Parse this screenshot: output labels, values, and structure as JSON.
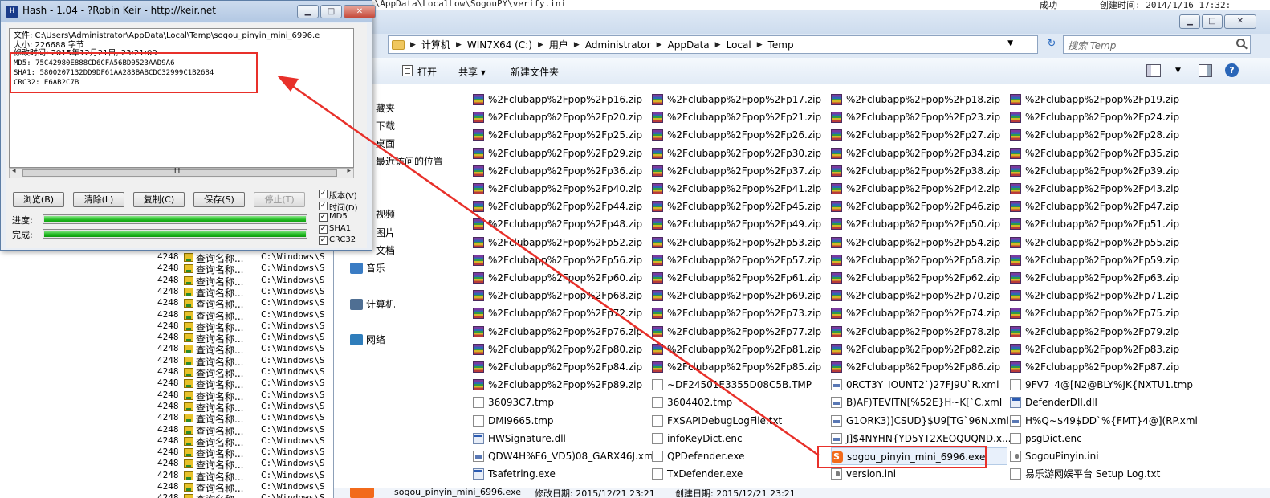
{
  "background_top": {
    "path_fragment": "r\\AppData\\LocalLow\\SogouPY\\verify.ini",
    "result": "成功",
    "created": "创建时间: 2014/1/16 17:32:"
  },
  "log": {
    "rows": [
      {
        "pid": "4248",
        "op": "查询名称...",
        "path": "C:\\Windows\\S"
      },
      {
        "pid": "4248",
        "op": "查询名称...",
        "path": "C:\\Windows\\S"
      },
      {
        "pid": "4248",
        "op": "查询名称...",
        "path": "C:\\Windows\\S"
      },
      {
        "pid": "4248",
        "op": "查询名称...",
        "path": "C:\\Windows\\S"
      },
      {
        "pid": "4248",
        "op": "查询名称...",
        "path": "C:\\Windows\\S"
      },
      {
        "pid": "4248",
        "op": "查询名称...",
        "path": "C:\\Windows\\S"
      },
      {
        "pid": "4248",
        "op": "查询名称...",
        "path": "C:\\Windows\\S"
      },
      {
        "pid": "4248",
        "op": "查询名称...",
        "path": "C:\\Windows\\S"
      },
      {
        "pid": "4248",
        "op": "查询名称...",
        "path": "C:\\Windows\\S"
      },
      {
        "pid": "4248",
        "op": "查询名称...",
        "path": "C:\\Windows\\S"
      },
      {
        "pid": "4248",
        "op": "查询名称...",
        "path": "C:\\Windows\\S"
      },
      {
        "pid": "4248",
        "op": "查询名称...",
        "path": "C:\\Windows\\S"
      },
      {
        "pid": "4248",
        "op": "查询名称...",
        "path": "C:\\Windows\\S"
      },
      {
        "pid": "4248",
        "op": "查询名称...",
        "path": "C:\\Windows\\S"
      },
      {
        "pid": "4248",
        "op": "查询名称...",
        "path": "C:\\Windows\\S"
      },
      {
        "pid": "4248",
        "op": "查询名称...",
        "path": "C:\\Windows\\S"
      },
      {
        "pid": "4248",
        "op": "查询名称...",
        "path": "C:\\Windows\\S"
      },
      {
        "pid": "4248",
        "op": "查询名称...",
        "path": "C:\\Windows\\S"
      },
      {
        "pid": "4248",
        "op": "查询名称...",
        "path": "C:\\Windows\\S"
      },
      {
        "pid": "4248",
        "op": "查询名称...",
        "path": "C:\\Windows\\S"
      },
      {
        "pid": "4248",
        "op": "查询名称...",
        "path": "C:\\Windows\\S"
      },
      {
        "pid": "4248",
        "op": "查询名称...",
        "path": "C:\\Windows\\S"
      }
    ]
  },
  "explorer": {
    "window_buttons": {
      "minimize": "▁",
      "maximize": "□",
      "close": "✕"
    },
    "address": {
      "crumbs": [
        "计算机",
        "WIN7X64 (C:)",
        "用户",
        "Administrator",
        "AppData",
        "Local",
        "Temp"
      ],
      "separator": "▶",
      "dropdown": "▼",
      "refresh": "↻"
    },
    "search": {
      "placeholder": "搜索 Temp"
    },
    "toolbar": {
      "open": "打开",
      "share": "共享 ▾",
      "new_folder": "新建文件夹",
      "view_dd": "▼",
      "help": "?"
    },
    "nav": {
      "items": [
        {
          "label": "藏夹",
          "color": "#e2b33a"
        },
        {
          "label": "下载",
          "color": "#4a7cc4"
        },
        {
          "label": "桌面",
          "color": "#5b9bd8"
        },
        {
          "label": "最近访问的位置",
          "color": "#6c8fb0"
        },
        {
          "label": "视频",
          "color": "#7f6ab0"
        },
        {
          "label": "图片",
          "color": "#3a9c6a"
        },
        {
          "label": "文档",
          "color": "#c6a04a"
        },
        {
          "label": "音乐",
          "color": "#3a7cc4"
        },
        {
          "label": "计算机",
          "color": "#4f6f93"
        },
        {
          "label": "网络",
          "color": "#2f7dbb"
        }
      ]
    },
    "files": {
      "columns": [
        [
          {
            "name": "%2Fclubapp%2Fpop%2Fp16.zip",
            "type": "zip"
          },
          {
            "name": "%2Fclubapp%2Fpop%2Fp20.zip",
            "type": "zip"
          },
          {
            "name": "%2Fclubapp%2Fpop%2Fp25.zip",
            "type": "zip"
          },
          {
            "name": "%2Fclubapp%2Fpop%2Fp29.zip",
            "type": "zip"
          },
          {
            "name": "%2Fclubapp%2Fpop%2Fp36.zip",
            "type": "zip"
          },
          {
            "name": "%2Fclubapp%2Fpop%2Fp40.zip",
            "type": "zip"
          },
          {
            "name": "%2Fclubapp%2Fpop%2Fp44.zip",
            "type": "zip"
          },
          {
            "name": "%2Fclubapp%2Fpop%2Fp48.zip",
            "type": "zip"
          },
          {
            "name": "%2Fclubapp%2Fpop%2Fp52.zip",
            "type": "zip"
          },
          {
            "name": "%2Fclubapp%2Fpop%2Fp56.zip",
            "type": "zip"
          },
          {
            "name": "%2Fclubapp%2Fpop%2Fp60.zip",
            "type": "zip"
          },
          {
            "name": "%2Fclubapp%2Fpop%2Fp68.zip",
            "type": "zip"
          },
          {
            "name": "%2Fclubapp%2Fpop%2Fp72.zip",
            "type": "zip"
          },
          {
            "name": "%2Fclubapp%2Fpop%2Fp76.zip",
            "type": "zip"
          },
          {
            "name": "%2Fclubapp%2Fpop%2Fp80.zip",
            "type": "zip"
          },
          {
            "name": "%2Fclubapp%2Fpop%2Fp84.zip",
            "type": "zip"
          },
          {
            "name": "%2Fclubapp%2Fpop%2Fp89.zip",
            "type": "zip"
          },
          {
            "name": "36093C7.tmp",
            "type": "doc"
          },
          {
            "name": "DMI9665.tmp",
            "type": "doc"
          },
          {
            "name": "HWSignature.dll",
            "type": "exe"
          },
          {
            "name": "QDW4H%F6_VD5)08_GARX46J.xml",
            "type": "xml"
          },
          {
            "name": "Tsafetring.exe",
            "type": "exe"
          }
        ],
        [
          {
            "name": "%2Fclubapp%2Fpop%2Fp17.zip",
            "type": "zip"
          },
          {
            "name": "%2Fclubapp%2Fpop%2Fp21.zip",
            "type": "zip"
          },
          {
            "name": "%2Fclubapp%2Fpop%2Fp26.zip",
            "type": "zip"
          },
          {
            "name": "%2Fclubapp%2Fpop%2Fp30.zip",
            "type": "zip"
          },
          {
            "name": "%2Fclubapp%2Fpop%2Fp37.zip",
            "type": "zip"
          },
          {
            "name": "%2Fclubapp%2Fpop%2Fp41.zip",
            "type": "zip"
          },
          {
            "name": "%2Fclubapp%2Fpop%2Fp45.zip",
            "type": "zip"
          },
          {
            "name": "%2Fclubapp%2Fpop%2Fp49.zip",
            "type": "zip"
          },
          {
            "name": "%2Fclubapp%2Fpop%2Fp53.zip",
            "type": "zip"
          },
          {
            "name": "%2Fclubapp%2Fpop%2Fp57.zip",
            "type": "zip"
          },
          {
            "name": "%2Fclubapp%2Fpop%2Fp61.zip",
            "type": "zip"
          },
          {
            "name": "%2Fclubapp%2Fpop%2Fp69.zip",
            "type": "zip"
          },
          {
            "name": "%2Fclubapp%2Fpop%2Fp73.zip",
            "type": "zip"
          },
          {
            "name": "%2Fclubapp%2Fpop%2Fp77.zip",
            "type": "zip"
          },
          {
            "name": "%2Fclubapp%2Fpop%2Fp81.zip",
            "type": "zip"
          },
          {
            "name": "%2Fclubapp%2Fpop%2Fp85.zip",
            "type": "zip"
          },
          {
            "name": "~DF24501E3355D08C5B.TMP",
            "type": "doc"
          },
          {
            "name": "3604402.tmp",
            "type": "doc"
          },
          {
            "name": "FXSAPIDebugLogFile.txt",
            "type": "doc"
          },
          {
            "name": "infoKeyDict.enc",
            "type": "doc"
          },
          {
            "name": "QPDefender.exe",
            "type": "doc"
          },
          {
            "name": "TxDefender.exe",
            "type": "doc"
          }
        ],
        [
          {
            "name": "%2Fclubapp%2Fpop%2Fp18.zip",
            "type": "zip"
          },
          {
            "name": "%2Fclubapp%2Fpop%2Fp23.zip",
            "type": "zip"
          },
          {
            "name": "%2Fclubapp%2Fpop%2Fp27.zip",
            "type": "zip"
          },
          {
            "name": "%2Fclubapp%2Fpop%2Fp34.zip",
            "type": "zip"
          },
          {
            "name": "%2Fclubapp%2Fpop%2Fp38.zip",
            "type": "zip"
          },
          {
            "name": "%2Fclubapp%2Fpop%2Fp42.zip",
            "type": "zip"
          },
          {
            "name": "%2Fclubapp%2Fpop%2Fp46.zip",
            "type": "zip"
          },
          {
            "name": "%2Fclubapp%2Fpop%2Fp50.zip",
            "type": "zip"
          },
          {
            "name": "%2Fclubapp%2Fpop%2Fp54.zip",
            "type": "zip"
          },
          {
            "name": "%2Fclubapp%2Fpop%2Fp58.zip",
            "type": "zip"
          },
          {
            "name": "%2Fclubapp%2Fpop%2Fp62.zip",
            "type": "zip"
          },
          {
            "name": "%2Fclubapp%2Fpop%2Fp70.zip",
            "type": "zip"
          },
          {
            "name": "%2Fclubapp%2Fpop%2Fp74.zip",
            "type": "zip"
          },
          {
            "name": "%2Fclubapp%2Fpop%2Fp78.zip",
            "type": "zip"
          },
          {
            "name": "%2Fclubapp%2Fpop%2Fp82.zip",
            "type": "zip"
          },
          {
            "name": "%2Fclubapp%2Fpop%2Fp86.zip",
            "type": "zip"
          },
          {
            "name": "0RCT3Y_IOUNT2`)27FJ9U`R.xml",
            "type": "xml"
          },
          {
            "name": "B)AF)TEVITN[%52E}H~K[`C.xml",
            "type": "xml"
          },
          {
            "name": "G1ORK3)]CSUD}$U9[TG`96N.xml",
            "type": "xml"
          },
          {
            "name": "J]$4NYHN{YD5YT2XEOQUQND.x...",
            "type": "xml"
          },
          {
            "name": "sogou_pinyin_mini_6996.exe",
            "type": "sogou"
          },
          {
            "name": "version.ini",
            "type": "ini"
          }
        ],
        [
          {
            "name": "%2Fclubapp%2Fpop%2Fp19.zip",
            "type": "zip"
          },
          {
            "name": "%2Fclubapp%2Fpop%2Fp24.zip",
            "type": "zip"
          },
          {
            "name": "%2Fclubapp%2Fpop%2Fp28.zip",
            "type": "zip"
          },
          {
            "name": "%2Fclubapp%2Fpop%2Fp35.zip",
            "type": "zip"
          },
          {
            "name": "%2Fclubapp%2Fpop%2Fp39.zip",
            "type": "zip"
          },
          {
            "name": "%2Fclubapp%2Fpop%2Fp43.zip",
            "type": "zip"
          },
          {
            "name": "%2Fclubapp%2Fpop%2Fp47.zip",
            "type": "zip"
          },
          {
            "name": "%2Fclubapp%2Fpop%2Fp51.zip",
            "type": "zip"
          },
          {
            "name": "%2Fclubapp%2Fpop%2Fp55.zip",
            "type": "zip"
          },
          {
            "name": "%2Fclubapp%2Fpop%2Fp59.zip",
            "type": "zip"
          },
          {
            "name": "%2Fclubapp%2Fpop%2Fp63.zip",
            "type": "zip"
          },
          {
            "name": "%2Fclubapp%2Fpop%2Fp71.zip",
            "type": "zip"
          },
          {
            "name": "%2Fclubapp%2Fpop%2Fp75.zip",
            "type": "zip"
          },
          {
            "name": "%2Fclubapp%2Fpop%2Fp79.zip",
            "type": "zip"
          },
          {
            "name": "%2Fclubapp%2Fpop%2Fp83.zip",
            "type": "zip"
          },
          {
            "name": "%2Fclubapp%2Fpop%2Fp87.zip",
            "type": "zip"
          },
          {
            "name": "9FV7_4@[N2@BLY%JK{NXTU1.tmp",
            "type": "doc"
          },
          {
            "name": "DefenderDll.dll",
            "type": "exe"
          },
          {
            "name": "H%Q~$49$DD`%{FMT}4@](RP.xml",
            "type": "xml"
          },
          {
            "name": "psgDict.enc",
            "type": "doc"
          },
          {
            "name": "SogouPinyin.ini",
            "type": "ini"
          },
          {
            "name": "易乐游网娱平台 Setup Log.txt",
            "type": "doc"
          }
        ]
      ]
    },
    "details": {
      "filename": "sogou_pinyin_mini_6996.exe",
      "modified": "修改日期: 2015/12/21 23:21",
      "created": "创建日期: 2015/12/21 23:21"
    }
  },
  "hash": {
    "title": "Hash - 1.04 - ?Robin Keir - http://keir.net",
    "logo": "H",
    "lines": {
      "file": "文件: C:\\Users\\Administrator\\AppData\\Local\\Temp\\sogou_pinyin_mini_6996.e",
      "size": "大小: 226688 字节",
      "modified": "修改时间: 2015年12月21日, 23:21:09",
      "md5": "MD5: 75C42980E888CD6CFA56BD0523AAD9A6",
      "sha1": "SHA1: 5800207132DD9DF61AA283BABCDC32999C1B2684",
      "crc32": "CRC32: E6AB2C7B"
    },
    "buttons": {
      "browse": "浏览(B)",
      "clear": "清除(L)",
      "copy": "复制(C)",
      "save": "保存(S)",
      "stop": "停止(T)"
    },
    "progress": {
      "label": "进度:",
      "value": 1.0
    },
    "complete": {
      "label": "完成:",
      "value": 1.0
    },
    "options": [
      {
        "label": "版本(V)",
        "checked": true
      },
      {
        "label": "时间(D)",
        "checked": true
      },
      {
        "label": "MD5",
        "checked": true
      },
      {
        "label": "SHA1",
        "checked": true
      },
      {
        "label": "CRC32",
        "checked": true
      }
    ],
    "scroll_glyphs": {
      "left": "◂",
      "right": "▸",
      "grip": "III"
    }
  },
  "annotation": {
    "color": "#e8302a"
  }
}
